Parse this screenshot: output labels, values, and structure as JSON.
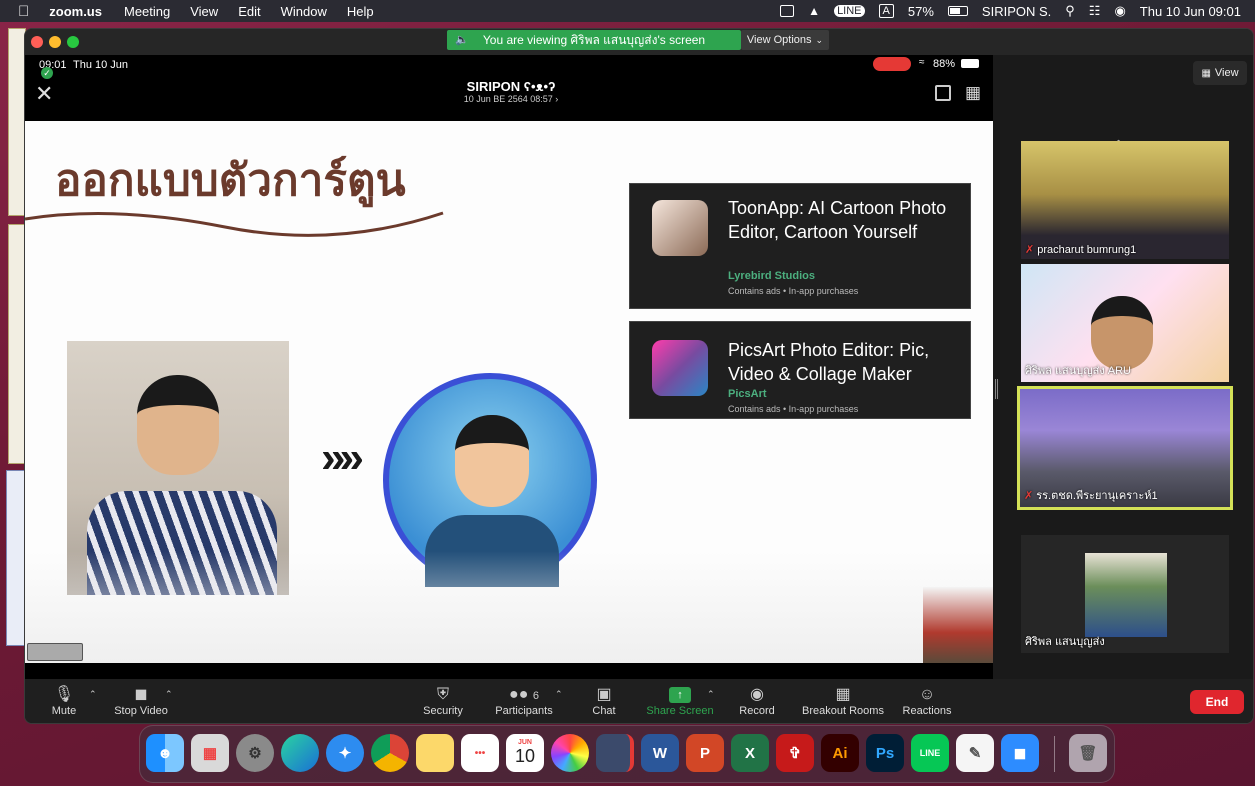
{
  "menubar": {
    "app": "zoom.us",
    "items": [
      "Meeting",
      "View",
      "Edit",
      "Window",
      "Help"
    ],
    "battery": "57%",
    "user": "SIRIPON S.",
    "clock": "Thu 10 Jun  09:01"
  },
  "zoom": {
    "banner": "You are viewing ศิริพล แสนบุญส่ง's screen",
    "view_options": "View Options",
    "view_button": "View",
    "phone": {
      "time": "09:01",
      "date": "Thu 10 Jun",
      "battery": "88%",
      "center_title": "SIRIPON ʕ•ᴥ•ʔ",
      "center_sub": "10 Jun BE 2564 08:57 ›"
    },
    "slide": {
      "title": "ออกแบบตัวการ์ตูน",
      "cards": [
        {
          "title": "ToonApp: AI Cartoon Photo Editor, Cartoon Yourself",
          "publisher": "Lyrebird Studios",
          "note": "Contains ads  •  In-app purchases"
        },
        {
          "title": "PicsArt Photo Editor: Pic, Video & Collage Maker",
          "publisher": "PicsArt",
          "note": "Contains ads  •  In-app purchases"
        }
      ]
    },
    "participants": [
      {
        "name": "pracharut bumrung1"
      },
      {
        "name": "ศิริพล แสนบุญส่ง ARU"
      },
      {
        "name": "รร.ตชด.พีระยานุเคราะห์1"
      },
      {
        "name": "ศิริพล แสนบุญส่ง"
      }
    ],
    "toolbar": {
      "mute": "Mute",
      "stop_video": "Stop Video",
      "security": "Security",
      "participants": "Participants",
      "participants_count": "6",
      "chat": "Chat",
      "share": "Share Screen",
      "record": "Record",
      "breakout": "Breakout Rooms",
      "reactions": "Reactions",
      "end": "End"
    }
  },
  "dock": {
    "calendar_month": "JUN",
    "calendar_day": "10",
    "ai_label": "Ai",
    "ps_label": "Ps",
    "line_label": "LINE"
  },
  "colors": {
    "share_green": "#2ea44f",
    "end_red": "#e0262e",
    "speaker_highlight": "#d4e157"
  }
}
